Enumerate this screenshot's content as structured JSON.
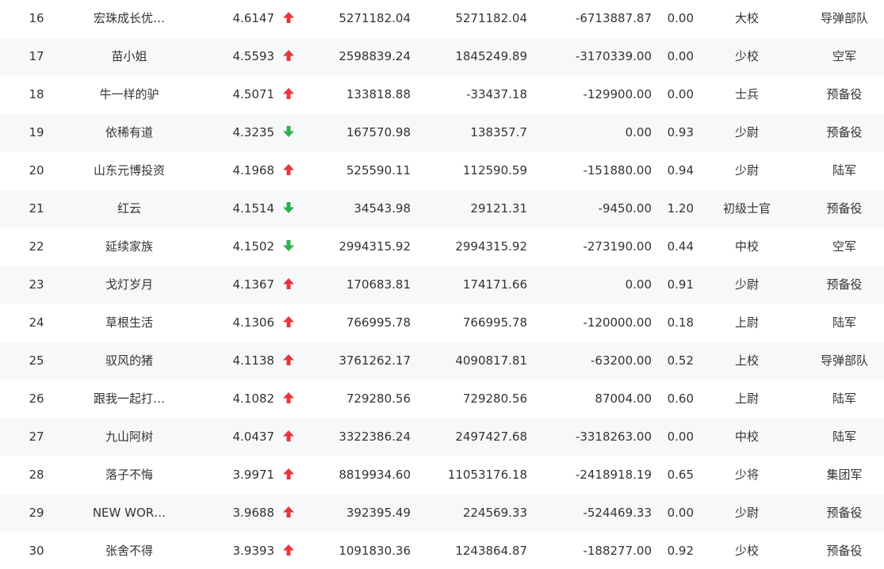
{
  "colors": {
    "up": "#e8363a",
    "down": "#2bb24c",
    "stripe": "#f7f8fa",
    "text": "#333333"
  },
  "rows": [
    {
      "rank": "16",
      "name": "宏珠成长优…",
      "score": "4.6147",
      "trend": "up",
      "v1": "5271182.04",
      "v2": "5271182.04",
      "v3": "-6713887.87",
      "ratio": "0.00",
      "title": "大校",
      "unit": "导弹部队"
    },
    {
      "rank": "17",
      "name": "苗小姐",
      "score": "4.5593",
      "trend": "up",
      "v1": "2598839.24",
      "v2": "1845249.89",
      "v3": "-3170339.00",
      "ratio": "0.00",
      "title": "少校",
      "unit": "空军"
    },
    {
      "rank": "18",
      "name": "牛一样的驴",
      "score": "4.5071",
      "trend": "up",
      "v1": "133818.88",
      "v2": "-33437.18",
      "v3": "-129900.00",
      "ratio": "0.00",
      "title": "士兵",
      "unit": "预备役"
    },
    {
      "rank": "19",
      "name": "依稀有道",
      "score": "4.3235",
      "trend": "down",
      "v1": "167570.98",
      "v2": "138357.7",
      "v3": "0.00",
      "ratio": "0.93",
      "title": "少尉",
      "unit": "预备役"
    },
    {
      "rank": "20",
      "name": "山东元博投资",
      "score": "4.1968",
      "trend": "up",
      "v1": "525590.11",
      "v2": "112590.59",
      "v3": "-151880.00",
      "ratio": "0.94",
      "title": "少尉",
      "unit": "陆军"
    },
    {
      "rank": "21",
      "name": "红云",
      "score": "4.1514",
      "trend": "down",
      "v1": "34543.98",
      "v2": "29121.31",
      "v3": "-9450.00",
      "ratio": "1.20",
      "title": "初级士官",
      "unit": "预备役"
    },
    {
      "rank": "22",
      "name": "延续家族",
      "score": "4.1502",
      "trend": "down",
      "v1": "2994315.92",
      "v2": "2994315.92",
      "v3": "-273190.00",
      "ratio": "0.44",
      "title": "中校",
      "unit": "空军"
    },
    {
      "rank": "23",
      "name": "戈灯岁月",
      "score": "4.1367",
      "trend": "up",
      "v1": "170683.81",
      "v2": "174171.66",
      "v3": "0.00",
      "ratio": "0.91",
      "title": "少尉",
      "unit": "预备役"
    },
    {
      "rank": "24",
      "name": "草根生活",
      "score": "4.1306",
      "trend": "up",
      "v1": "766995.78",
      "v2": "766995.78",
      "v3": "-120000.00",
      "ratio": "0.18",
      "title": "上尉",
      "unit": "陆军"
    },
    {
      "rank": "25",
      "name": "驭风的猪",
      "score": "4.1138",
      "trend": "up",
      "v1": "3761262.17",
      "v2": "4090817.81",
      "v3": "-63200.00",
      "ratio": "0.52",
      "title": "上校",
      "unit": "导弹部队"
    },
    {
      "rank": "26",
      "name": "跟我一起打…",
      "score": "4.1082",
      "trend": "up",
      "v1": "729280.56",
      "v2": "729280.56",
      "v3": "87004.00",
      "ratio": "0.60",
      "title": "上尉",
      "unit": "陆军"
    },
    {
      "rank": "27",
      "name": "九山阿树",
      "score": "4.0437",
      "trend": "up",
      "v1": "3322386.24",
      "v2": "2497427.68",
      "v3": "-3318263.00",
      "ratio": "0.00",
      "title": "中校",
      "unit": "陆军"
    },
    {
      "rank": "28",
      "name": "落子不悔",
      "score": "3.9971",
      "trend": "up",
      "v1": "8819934.60",
      "v2": "11053176.18",
      "v3": "-2418918.19",
      "ratio": "0.65",
      "title": "少将",
      "unit": "集团军"
    },
    {
      "rank": "29",
      "name": "NEW WOR…",
      "score": "3.9688",
      "trend": "up",
      "v1": "392395.49",
      "v2": "224569.33",
      "v3": "-524469.33",
      "ratio": "0.00",
      "title": "少尉",
      "unit": "预备役"
    },
    {
      "rank": "30",
      "name": "张舍不得",
      "score": "3.9393",
      "trend": "up",
      "v1": "1091830.36",
      "v2": "1243864.87",
      "v3": "-188277.00",
      "ratio": "0.92",
      "title": "少校",
      "unit": "预备役"
    }
  ]
}
